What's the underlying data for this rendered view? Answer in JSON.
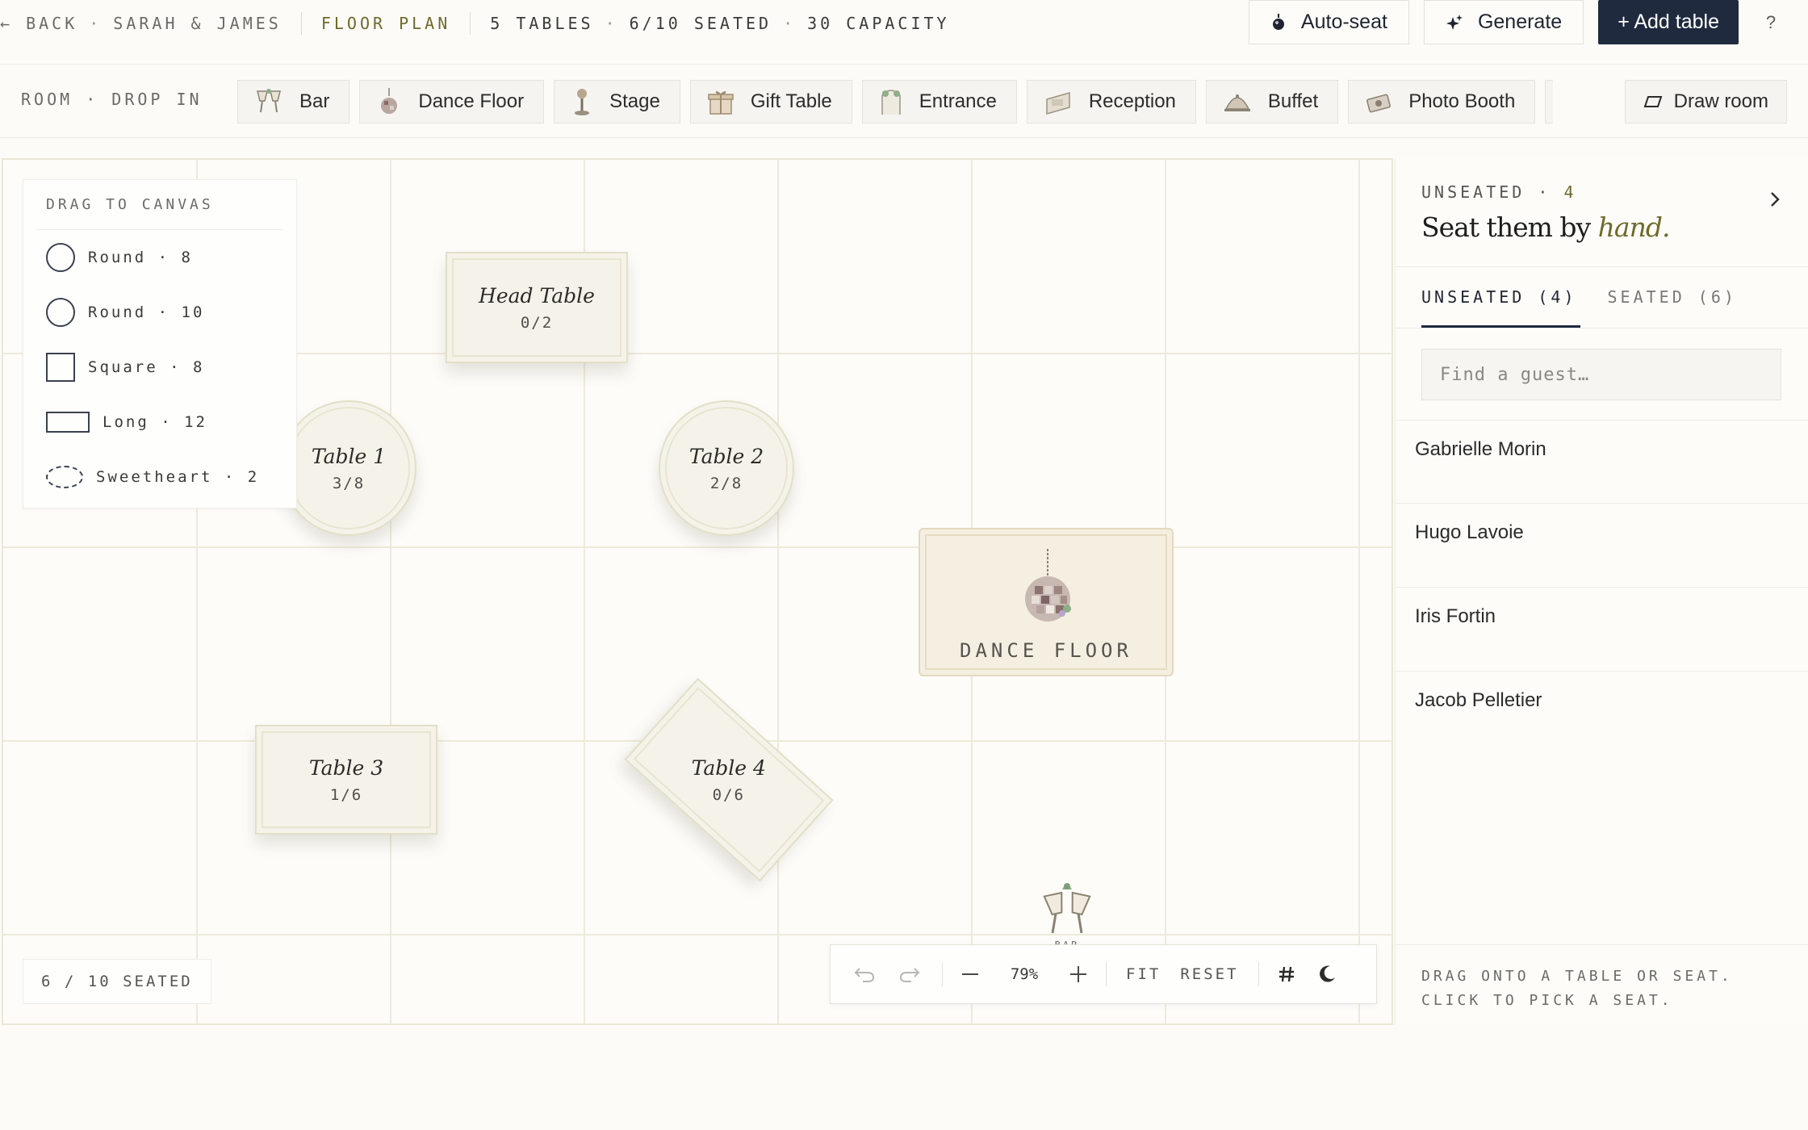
{
  "header": {
    "back": "← BACK",
    "event": "SARAH & JAMES",
    "section": "FLOOR PLAN",
    "tables": "5 TABLES",
    "seated": "6/10 SEATED",
    "capacity": "30 CAPACITY",
    "autoseat_label": "Auto-seat",
    "generate_label": "Generate",
    "add_table_label": "+ Add table",
    "help_label": "?"
  },
  "roombar": {
    "label": "ROOM · DROP IN",
    "items": [
      {
        "label": "Bar",
        "icon": "bar-icon"
      },
      {
        "label": "Dance Floor",
        "icon": "disco-ball-icon"
      },
      {
        "label": "Stage",
        "icon": "microphone-icon"
      },
      {
        "label": "Gift Table",
        "icon": "gift-icon"
      },
      {
        "label": "Entrance",
        "icon": "entrance-icon"
      },
      {
        "label": "Reception",
        "icon": "reception-icon"
      },
      {
        "label": "Buffet",
        "icon": "cloche-icon"
      },
      {
        "label": "Photo Booth",
        "icon": "camera-icon"
      }
    ],
    "draw_room_label": "Draw room"
  },
  "palette": {
    "title": "DRAG TO CANVAS",
    "items": [
      {
        "label": "Round · 8",
        "shape": "circle"
      },
      {
        "label": "Round · 10",
        "shape": "circle"
      },
      {
        "label": "Square · 8",
        "shape": "square"
      },
      {
        "label": "Long · 12",
        "shape": "long"
      },
      {
        "label": "Sweetheart · 2",
        "shape": "sweetheart"
      }
    ]
  },
  "canvas": {
    "tables": [
      {
        "name": "Head Table",
        "count": "0/2",
        "shape": "rect"
      },
      {
        "name": "Table 1",
        "count": "3/8",
        "shape": "round"
      },
      {
        "name": "Table 2",
        "count": "2/8",
        "shape": "round"
      },
      {
        "name": "Table 3",
        "count": "1/6",
        "shape": "rect"
      },
      {
        "name": "Table 4",
        "count": "0/6",
        "shape": "rect-rotated"
      }
    ],
    "dance_floor_label": "DANCE FLOOR",
    "bar_label": "BAR",
    "seated_badge": "6 / 10 SEATED",
    "zoom": "79%",
    "fit_label": "FIT",
    "reset_label": "RESET"
  },
  "panel": {
    "kicker": "UNSEATED",
    "kicker_count": "4",
    "title_prefix": "Seat them by ",
    "title_emphasis": "hand.",
    "tabs": [
      {
        "label": "UNSEATED (4)",
        "active": true
      },
      {
        "label": "SEATED (6)",
        "active": false
      }
    ],
    "search_placeholder": "Find a guest…",
    "guests": [
      "Gabrielle Morin",
      "Hugo Lavoie",
      "Iris Fortin",
      "Jacob Pelletier"
    ],
    "footer_line1": "DRAG ONTO A TABLE OR SEAT.",
    "footer_line2": "CLICK TO PICK A SEAT."
  },
  "colors": {
    "accent_olive": "#6e6a2a",
    "primary_navy": "#1f2a3e",
    "table_fill": "#f5f3e9"
  }
}
